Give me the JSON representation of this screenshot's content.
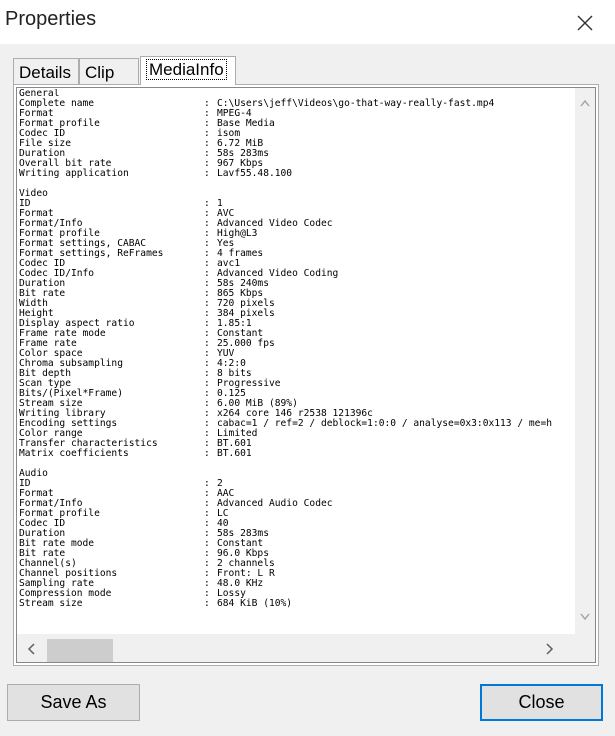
{
  "window": {
    "title": "Properties",
    "close_glyph": "close-icon"
  },
  "tabs": [
    {
      "label": "Details"
    },
    {
      "label": "Clip"
    },
    {
      "label": "MediaInfo",
      "selected": true
    }
  ],
  "mediainfo": {
    "lines": [
      {
        "label": "General",
        "value": ""
      },
      {
        "label": "Complete name",
        "value": "C:\\Users\\jeff\\Videos\\go-that-way-really-fast.mp4"
      },
      {
        "label": "Format",
        "value": "MPEG-4"
      },
      {
        "label": "Format profile",
        "value": "Base Media"
      },
      {
        "label": "Codec ID",
        "value": "isom"
      },
      {
        "label": "File size",
        "value": "6.72 MiB"
      },
      {
        "label": "Duration",
        "value": "58s 283ms"
      },
      {
        "label": "Overall bit rate",
        "value": "967 Kbps"
      },
      {
        "label": "Writing application",
        "value": "Lavf55.48.100"
      },
      {
        "label": "",
        "value": ""
      },
      {
        "label": "Video",
        "value": ""
      },
      {
        "label": "ID",
        "value": "1"
      },
      {
        "label": "Format",
        "value": "AVC"
      },
      {
        "label": "Format/Info",
        "value": "Advanced Video Codec"
      },
      {
        "label": "Format profile",
        "value": "High@L3"
      },
      {
        "label": "Format settings, CABAC",
        "value": "Yes"
      },
      {
        "label": "Format settings, ReFrames",
        "value": "4 frames"
      },
      {
        "label": "Codec ID",
        "value": "avc1"
      },
      {
        "label": "Codec ID/Info",
        "value": "Advanced Video Coding"
      },
      {
        "label": "Duration",
        "value": "58s 240ms"
      },
      {
        "label": "Bit rate",
        "value": "865 Kbps"
      },
      {
        "label": "Width",
        "value": "720 pixels"
      },
      {
        "label": "Height",
        "value": "384 pixels"
      },
      {
        "label": "Display aspect ratio",
        "value": "1.85:1"
      },
      {
        "label": "Frame rate mode",
        "value": "Constant"
      },
      {
        "label": "Frame rate",
        "value": "25.000 fps"
      },
      {
        "label": "Color space",
        "value": "YUV"
      },
      {
        "label": "Chroma subsampling",
        "value": "4:2:0"
      },
      {
        "label": "Bit depth",
        "value": "8 bits"
      },
      {
        "label": "Scan type",
        "value": "Progressive"
      },
      {
        "label": "Bits/(Pixel*Frame)",
        "value": "0.125"
      },
      {
        "label": "Stream size",
        "value": "6.00 MiB (89%)"
      },
      {
        "label": "Writing library",
        "value": "x264 core 146 r2538 121396c"
      },
      {
        "label": "Encoding settings",
        "value": "cabac=1 / ref=2 / deblock=1:0:0 / analyse=0x3:0x113 / me=h"
      },
      {
        "label": "Color range",
        "value": "Limited"
      },
      {
        "label": "Transfer characteristics",
        "value": "BT.601"
      },
      {
        "label": "Matrix coefficients",
        "value": "BT.601"
      },
      {
        "label": "",
        "value": ""
      },
      {
        "label": "Audio",
        "value": ""
      },
      {
        "label": "ID",
        "value": "2"
      },
      {
        "label": "Format",
        "value": "AAC"
      },
      {
        "label": "Format/Info",
        "value": "Advanced Audio Codec"
      },
      {
        "label": "Format profile",
        "value": "LC"
      },
      {
        "label": "Codec ID",
        "value": "40"
      },
      {
        "label": "Duration",
        "value": "58s 283ms"
      },
      {
        "label": "Bit rate mode",
        "value": "Constant"
      },
      {
        "label": "Bit rate",
        "value": "96.0 Kbps"
      },
      {
        "label": "Channel(s)",
        "value": "2 channels"
      },
      {
        "label": "Channel positions",
        "value": "Front: L R"
      },
      {
        "label": "Sampling rate",
        "value": "48.0 KHz"
      },
      {
        "label": "Compression mode",
        "value": "Lossy"
      },
      {
        "label": "Stream size",
        "value": "684 KiB (10%)"
      }
    ]
  },
  "buttons": {
    "save_as": "Save As",
    "close": "Close"
  },
  "colors": {
    "accent": "#0078d7"
  }
}
